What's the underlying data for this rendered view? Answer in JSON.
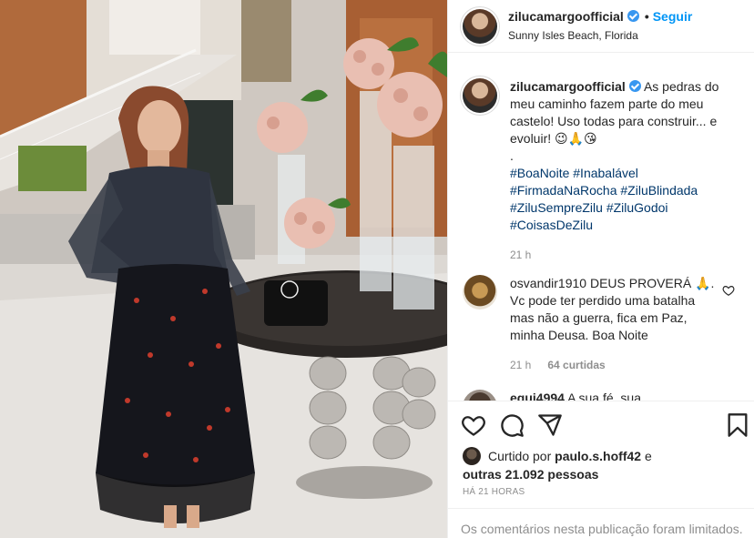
{
  "header": {
    "username": "zilucamargoofficial",
    "follow_label": "Seguir",
    "location": "Sunny Isles Beach, Florida"
  },
  "caption": {
    "username": "zilucamargoofficial",
    "text": "As pedras do meu caminho fazem parte do meu castelo! Uso todas para construir... e evoluir! 😉🙏😘",
    "separator": ".",
    "hashtags": [
      "#BoaNoite #Inabalável",
      "#FirmadaNaRocha #ZiluBlindada",
      "#ZiluSempreZilu #ZiluGodoi",
      "#CoisasDeZilu"
    ],
    "time": "21 h"
  },
  "comments": [
    {
      "username": "osvandir1910",
      "text": "DEUS PROVERÁ 🙏. Vc pode ter perdido uma batalha mas não a guerra, fica em Paz, minha Deusa. Boa Noite",
      "time": "21 h",
      "likes": "64 curtidas"
    },
    {
      "username": "equi4994",
      "text": "A sua fé, sua"
    }
  ],
  "likes": {
    "prefix": "Curtido por",
    "user": "paulo.s.hoff42",
    "and": "e",
    "others": "outras 21.092 pessoas"
  },
  "time_ago": "HÁ 21 HORAS",
  "comments_limited": "Os comentários nesta publicação foram limitados.",
  "icons": [
    "heart-icon",
    "comment-icon",
    "share-icon",
    "bookmark-icon"
  ],
  "colors": {
    "link": "#00376b",
    "follow": "#0095f6",
    "muted": "#8e8e8e",
    "verified": "#3897f0"
  }
}
